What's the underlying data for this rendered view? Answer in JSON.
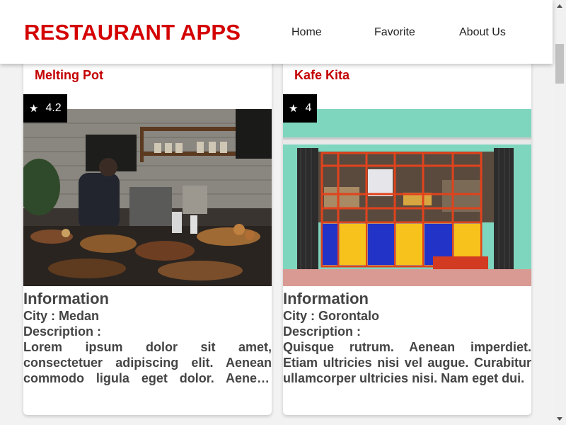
{
  "header": {
    "brand": "RESTAURANT APPS",
    "nav": {
      "home": "Home",
      "favorite": "Favorite",
      "about": "About Us"
    }
  },
  "restaurants": [
    {
      "name": "Melting Pot",
      "rating": "4.2",
      "info_heading": "Information",
      "city": "City : Medan",
      "description_label": "Description :",
      "description": "Lorem ipsum dolor sit amet, consectetuer adipiscing elit. Aenean commodo ligula eget dolor. Aenean massa."
    },
    {
      "name": "Kafe Kita",
      "rating": "4",
      "info_heading": "Information",
      "city": "City : Gorontalo",
      "description_label": "Description :",
      "description": "Quisque rutrum. Aenean imperdiet. Etiam ultricies nisi vel augue. Curabitur ullamcorper ultricies nisi. Nam eget dui."
    }
  ],
  "icons": {
    "rating": "star-icon",
    "scroll_up": "chevron-up-icon",
    "scroll_down": "chevron-down-icon"
  },
  "colors": {
    "brand": "#d40000",
    "card_name": "#c40000",
    "rating_badge": "#000000"
  }
}
